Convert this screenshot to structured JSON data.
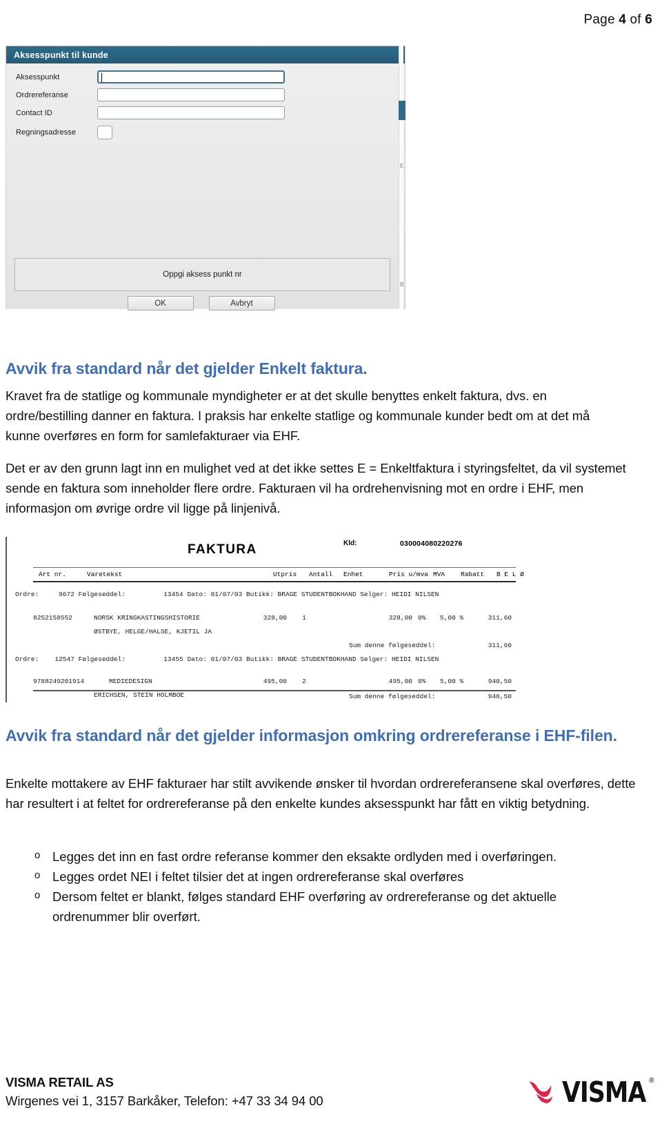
{
  "page_header": {
    "prefix": "Page",
    "current": "4",
    "middle": "of",
    "total": "6"
  },
  "dialog": {
    "title": "Aksesspunkt til kunde",
    "fields": [
      {
        "label": "Aksesspunkt",
        "value": "",
        "type": "text"
      },
      {
        "label": "Ordrereferanse",
        "value": "",
        "type": "text"
      },
      {
        "label": "Contact ID",
        "value": "",
        "type": "text"
      },
      {
        "label": "Regningsadresse",
        "value": "",
        "type": "checkbox"
      }
    ],
    "message": "Oppgi aksess punkt nr",
    "ok_label": "OK",
    "cancel_label": "Avbryt",
    "titlebar_color": "#2a6381"
  },
  "section1": {
    "heading": "Avvik fra standard når det gjelder Enkelt faktura.",
    "paragraph1": "Kravet fra de statlige og kommunale myndigheter er at det skulle benyttes enkelt faktura, dvs. en ordre/bestilling danner en faktura. I praksis har enkelte statlige og kommunale kunder bedt om at det må kunne overføres en form for samlefakturaer via EHF.",
    "paragraph2": "Det er av den grunn lagt inn en mulighet ved at det ikke settes E = Enkeltfaktura i styringsfeltet, da vil systemet sende en faktura som inneholder flere ordre. Fakturaen vil ha ordrehenvisning mot en ordre i EHF, men informasjon om øvrige ordre vil ligge på linjenivå."
  },
  "invoice": {
    "title": "FAKTURA",
    "kid_label": "Kld:",
    "kid_value": "030004080220276",
    "columns": [
      "Art nr.",
      "Varetekst",
      "Utpris",
      "Antall",
      "Enhet",
      "Pris u/mva",
      "MVA",
      "Rabatt",
      "B E L Ø P"
    ],
    "groups": [
      {
        "order_label": "Ordre:",
        "order_no": "9672",
        "delivery_label": "Følgeseddel:",
        "delivery_no": "13454",
        "date_label": "Dato:",
        "date": "01/07/03",
        "shop_label": "Butikk:",
        "shop": "BRAGE STUDENTBOKHAND",
        "seller_label": "Selger:",
        "seller": "HEIDI NILSEN",
        "lines": [
          {
            "art_nr": "8252158552",
            "text": "NORSK KRINGKASTINGSHISTORIE",
            "author": "ØSTBYE, HELGE/HALSE, KJETIL JA",
            "utpris": "328,00",
            "antall": "1",
            "enhet": "",
            "pris_u_mva": "328,00",
            "mva": "0%",
            "rabatt": "5,00 %",
            "belop": "311,60"
          }
        ],
        "sum_label": "Sum denne følgeseddel:",
        "sum_value": "311,60"
      },
      {
        "order_label": "Ordre:",
        "order_no": "12547",
        "delivery_label": "Følgeseddel:",
        "delivery_no": "13455",
        "date_label": "Dato:",
        "date": "01/07/03",
        "shop_label": "Butikk:",
        "shop": "BRAGE STUDENTBOKHAND",
        "seller_label": "Selger:",
        "seller": "HEIDI NILSEN",
        "lines": [
          {
            "art_nr": "9788249201914",
            "text": "MEDIEDESIGN",
            "author": "ERICHSEN, STEIN HOLMBOE",
            "utpris": "495,00",
            "antall": "2",
            "enhet": "",
            "pris_u_mva": "495,00",
            "mva": "0%",
            "rabatt": "5,00 %",
            "belop": "940,50"
          }
        ],
        "sum_label": "Sum denne følgeseddel:",
        "sum_value": "940,50"
      }
    ]
  },
  "section2": {
    "heading": "Avvik fra standard når det gjelder informasjon omkring ordrereferanse i EHF-filen.",
    "paragraph": "Enkelte mottakere av EHF fakturaer har stilt avvikende ønsker til hvordan ordrereferansene skal overføres, dette har resultert i at feltet for ordrereferanse på den enkelte kundes aksesspunkt har fått en viktig betydning.",
    "bullets": [
      "Legges det inn en fast ordre referanse kommer den eksakte ordlyden med i overføringen.",
      "Legges ordet NEI i feltet tilsier det at ingen ordrereferanse skal overføres",
      "Dersom feltet er blankt, følges standard EHF overføring av ordrereferanse og det aktuelle ordrenummer blir overført."
    ],
    "bullet_marker": "o"
  },
  "footer": {
    "company": "VISMA RETAIL AS",
    "address": "Wirgenes vei 1, 3157 Barkåker, Telefon: +47 33 34 94 00",
    "logo_word": "VISMA",
    "logo_reg": "®",
    "logo_color": "#e0234a"
  }
}
